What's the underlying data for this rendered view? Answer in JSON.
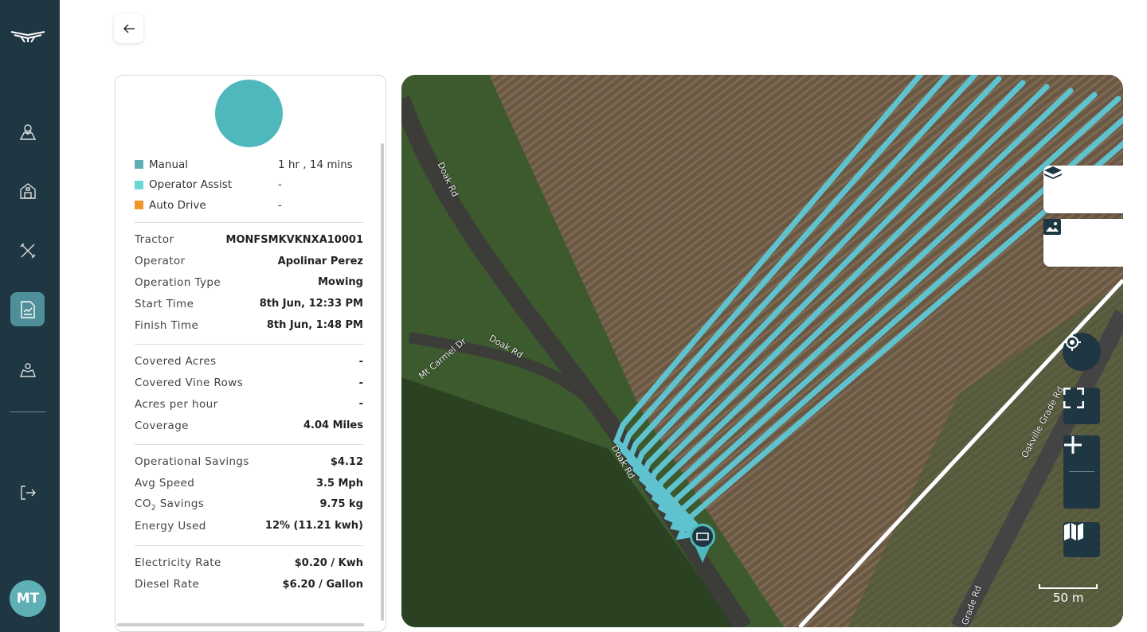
{
  "sidebar": {
    "items": [
      "field-map",
      "farm",
      "maintenance",
      "reports",
      "locations",
      "logout"
    ],
    "active": "reports",
    "avatar": "MT"
  },
  "summary": {
    "legend": [
      {
        "label": "Manual",
        "value": "1 hr , 14 mins",
        "color": "#5fb0b5"
      },
      {
        "label": "Operator Assist",
        "value": "-",
        "color": "#6ad6d0"
      },
      {
        "label": "Auto Drive",
        "value": "-",
        "color": "#f0962a"
      }
    ],
    "details": [
      {
        "k": "Tractor",
        "v": "MONFSMKVKNXA10001"
      },
      {
        "k": "Operator",
        "v": "Apolinar Perez"
      },
      {
        "k": "Operation Type",
        "v": "Mowing"
      },
      {
        "k": "Start Time",
        "v": "8th Jun, 12:33 PM"
      },
      {
        "k": "Finish Time",
        "v": "8th Jun, 1:48 PM"
      }
    ],
    "coverage": [
      {
        "k": "Covered Acres",
        "v": "-"
      },
      {
        "k": "Covered Vine Rows",
        "v": "-"
      },
      {
        "k": "Acres per hour",
        "v": "-"
      },
      {
        "k": "Coverage",
        "v": "4.04 Miles"
      }
    ],
    "savings": [
      {
        "k": "Operational Savings",
        "v": "$4.12"
      },
      {
        "k": "Avg Speed",
        "v": "3.5 Mph"
      },
      {
        "k": "CO",
        "sub": "2",
        "k2": " Savings",
        "v": "9.75 kg"
      },
      {
        "k": "Energy Used",
        "v": "12% (11.21 kwh)"
      }
    ],
    "rates": [
      {
        "k": "Electricity Rate",
        "v": "$0.20 / Kwh"
      },
      {
        "k": "Diesel Rate",
        "v": "$6.20 / Gallon"
      }
    ]
  },
  "map": {
    "roads": [
      "Doak Rd",
      "Mt Carmel Dr",
      "Doak Rd",
      "Doak Rd",
      "Oakville Grade Rd",
      "Grade Rd"
    ],
    "scale": "50 m",
    "path_color": "#5ec3cf"
  }
}
